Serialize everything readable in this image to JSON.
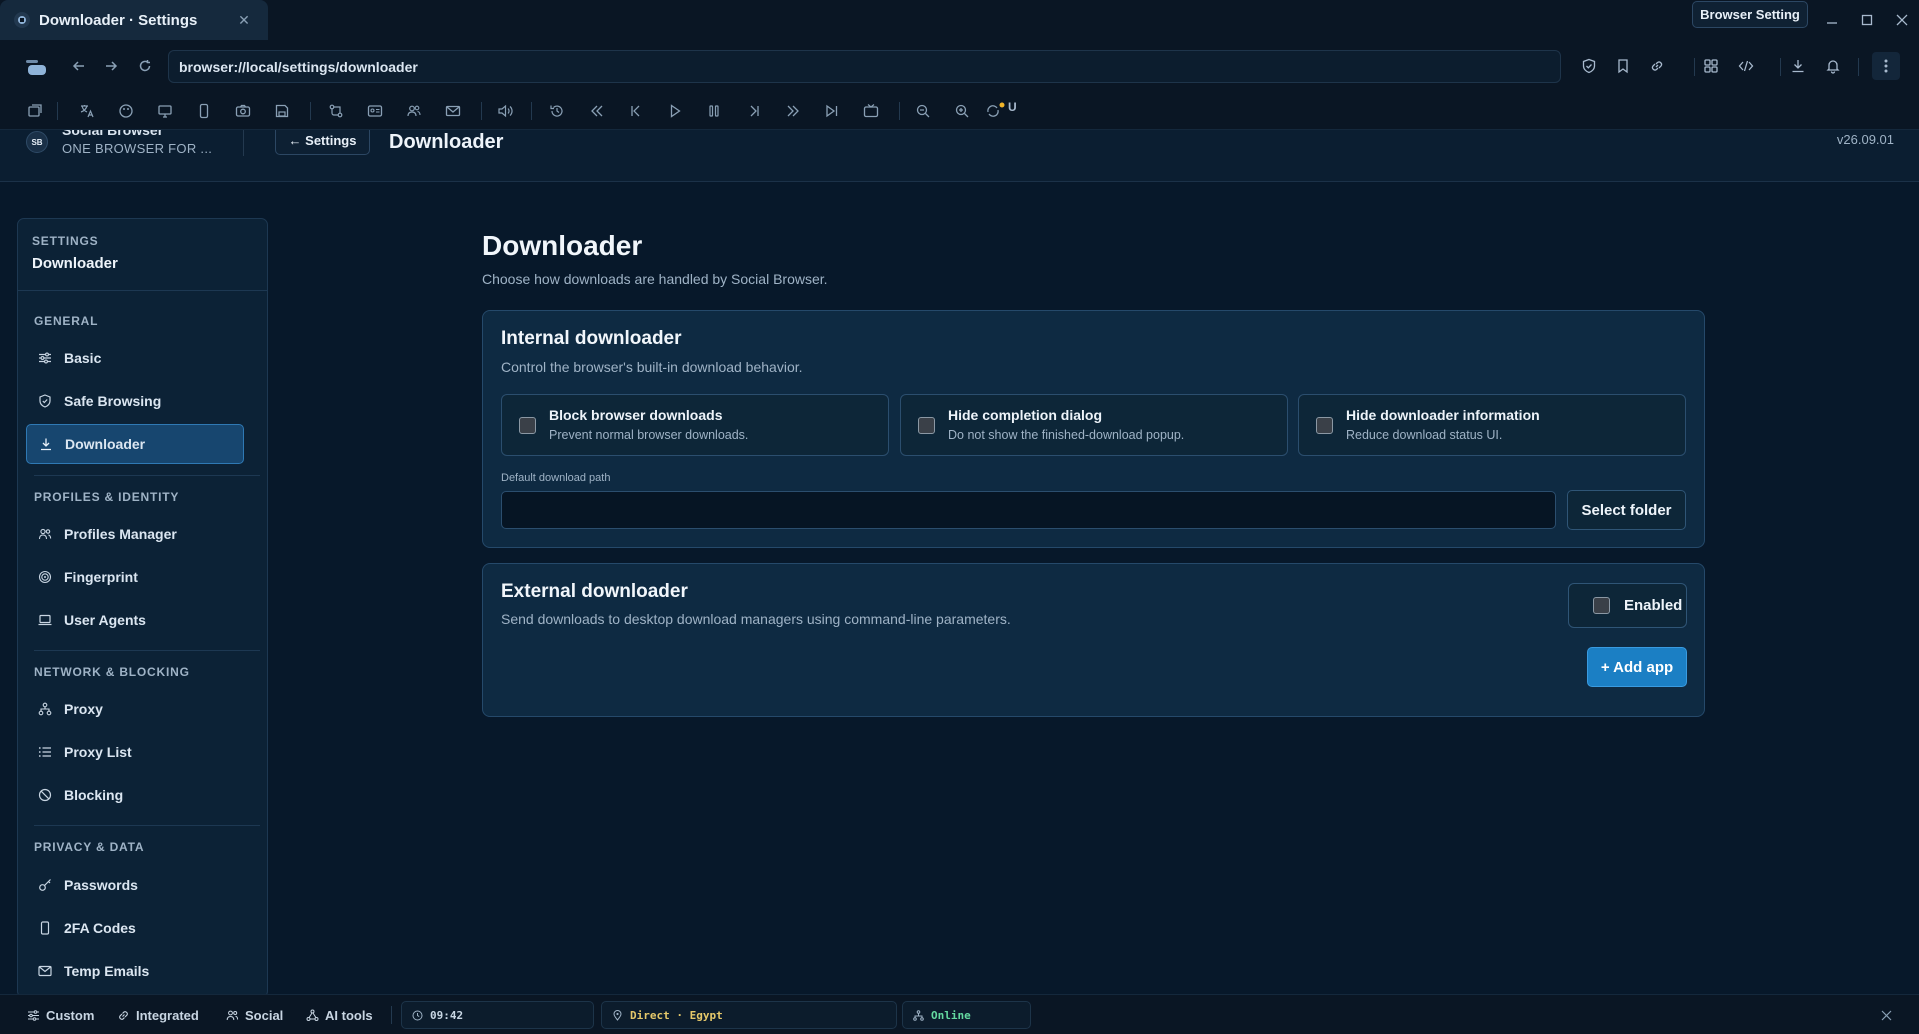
{
  "window": {
    "tab_title": "Downloader · Settings",
    "setting_button": "Browser Setting"
  },
  "address_bar": {
    "url": "browser://local/settings/downloader"
  },
  "page_header": {
    "brand_logo": "SB",
    "brand_name": "Social Browser",
    "brand_tagline": "ONE BROWSER FOR ...",
    "back_button": "← Settings",
    "title": "Downloader",
    "version": "v26.09.01"
  },
  "toolbar": {
    "badge_letter": "U"
  },
  "sidebar": {
    "caption": "SETTINGS",
    "current": "Downloader",
    "groups": [
      {
        "title": "GENERAL",
        "items": [
          {
            "label": "Basic",
            "icon": "sliders-icon"
          },
          {
            "label": "Safe Browsing",
            "icon": "shield-icon"
          },
          {
            "label": "Downloader",
            "icon": "download-icon",
            "active": true
          }
        ]
      },
      {
        "title": "PROFILES & IDENTITY",
        "items": [
          {
            "label": "Profiles Manager",
            "icon": "users-icon"
          },
          {
            "label": "Fingerprint",
            "icon": "fingerprint-icon"
          },
          {
            "label": "User Agents",
            "icon": "laptop-icon"
          }
        ]
      },
      {
        "title": "NETWORK & BLOCKING",
        "items": [
          {
            "label": "Proxy",
            "icon": "network-icon"
          },
          {
            "label": "Proxy List",
            "icon": "list-icon"
          },
          {
            "label": "Blocking",
            "icon": "block-icon"
          }
        ]
      },
      {
        "title": "PRIVACY & DATA",
        "items": [
          {
            "label": "Passwords",
            "icon": "key-icon"
          },
          {
            "label": "2FA Codes",
            "icon": "phone-icon"
          },
          {
            "label": "Temp Emails",
            "icon": "mail-icon"
          }
        ]
      }
    ]
  },
  "main": {
    "title": "Downloader",
    "subtitle": "Choose how downloads are handled by Social Browser.",
    "internal": {
      "title": "Internal downloader",
      "description": "Control the browser's built-in download behavior.",
      "options": [
        {
          "title": "Block browser downloads",
          "description": "Prevent normal browser downloads.",
          "checked": false
        },
        {
          "title": "Hide completion dialog",
          "description": "Do not show the finished-download popup.",
          "checked": false
        },
        {
          "title": "Hide downloader information",
          "description": "Reduce download status UI.",
          "checked": false
        }
      ],
      "path_label": "Default download path",
      "path_value": "",
      "select_folder": "Select folder"
    },
    "external": {
      "title": "External downloader",
      "description": "Send downloads to desktop download managers using command-line parameters.",
      "enabled_label": "Enabled",
      "enabled": false,
      "add_app": "+ Add app"
    }
  },
  "statusbar": {
    "custom": "Custom",
    "integrated": "Integrated",
    "social": "Social",
    "ai_tools": "AI tools",
    "clock": "09:42",
    "proxy": "Direct · Egypt",
    "status": "Online"
  },
  "colors": {
    "accent": "#1b7fc4",
    "active_nav": "#17466f",
    "clock_text": "#c9d7e4",
    "proxy_text": "#e5c86a",
    "online_text": "#64d9a0"
  }
}
